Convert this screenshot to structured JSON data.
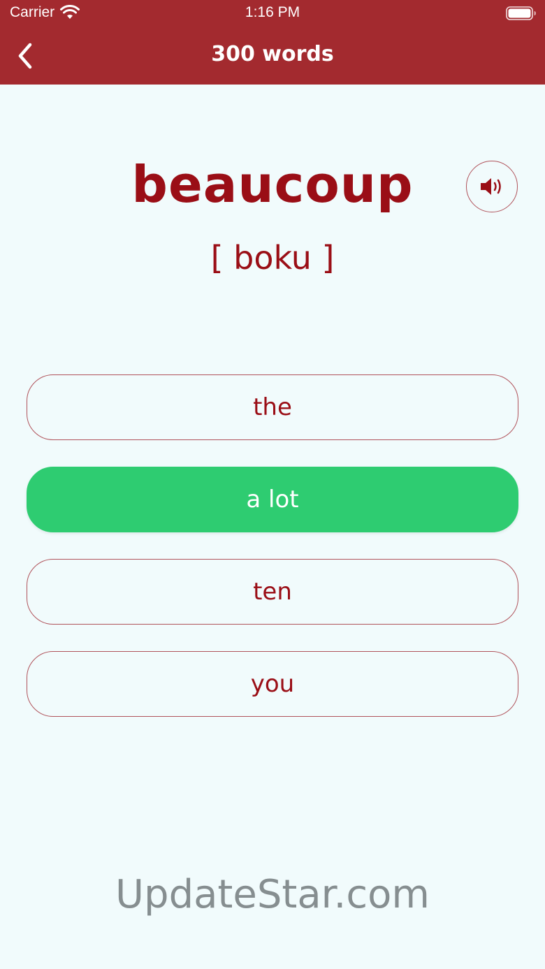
{
  "status_bar": {
    "carrier": "Carrier",
    "time": "1:16 PM"
  },
  "nav": {
    "title": "300 words",
    "back_icon": "chevron-left-icon"
  },
  "card": {
    "word": "beaucoup",
    "pronunciation": "[ boku ]",
    "speaker_icon": "speaker-icon"
  },
  "options": [
    {
      "label": "the",
      "selected": false
    },
    {
      "label": "a lot",
      "selected": true
    },
    {
      "label": "ten",
      "selected": false
    },
    {
      "label": "you",
      "selected": false
    }
  ],
  "watermark": "UpdateStar.com",
  "colors": {
    "header": "#a32a2f",
    "accent_text": "#9a0e16",
    "correct": "#2ecc71",
    "background": "#f1fbfc"
  }
}
